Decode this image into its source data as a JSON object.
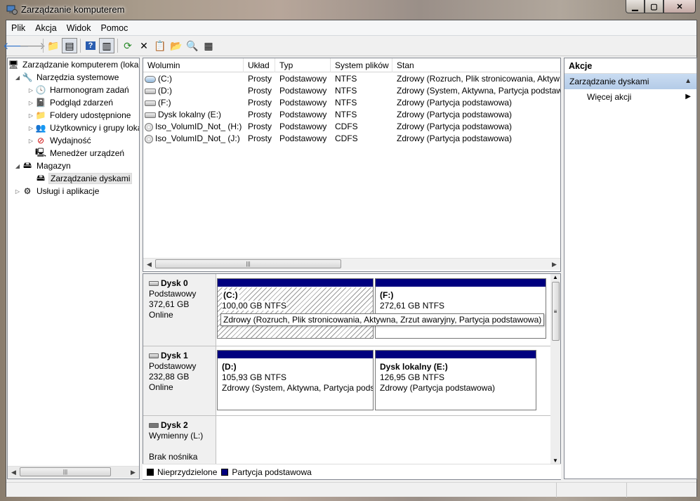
{
  "window": {
    "title": "Zarządzanie komputerem"
  },
  "menu": [
    "Plik",
    "Akcja",
    "Widok",
    "Pomoc"
  ],
  "toolbar_icons": [
    "back-icon",
    "forward-icon",
    "up-folder-icon",
    "show-tree-icon",
    "help-icon",
    "show-action-pane-icon",
    "refresh-icon",
    "delete-icon",
    "properties-icon",
    "open-icon",
    "find-icon",
    "settings-icon"
  ],
  "tree": {
    "root": "Zarządzanie komputerem (lokalne)",
    "system_tools": "Narzędzia systemowe",
    "task_scheduler": "Harmonogram zadań",
    "event_viewer": "Podgląd zdarzeń",
    "shared_folders": "Foldery udostępnione",
    "users_groups": "Użytkownicy i grupy lokalne",
    "performance": "Wydajność",
    "device_manager": "Menedżer urządzeń",
    "storage": "Magazyn",
    "disk_management": "Zarządzanie dyskami",
    "services_apps": "Usługi i aplikacje"
  },
  "volumes": {
    "columns": [
      "Wolumin",
      "Układ",
      "Typ",
      "System plików",
      "Stan"
    ],
    "rows": [
      {
        "name": "(C:)",
        "layout": "Prosty",
        "type": "Podstawowy",
        "fs": "NTFS",
        "status": "Zdrowy (Rozruch, Plik stronicowania, Aktywna, Zrzut awaryjny, Partycja podstawowa)",
        "icon": "volume-icon"
      },
      {
        "name": "(D:)",
        "layout": "Prosty",
        "type": "Podstawowy",
        "fs": "NTFS",
        "status": "Zdrowy (System, Aktywna, Partycja podstawowa)",
        "icon": "hdd-icon"
      },
      {
        "name": "(F:)",
        "layout": "Prosty",
        "type": "Podstawowy",
        "fs": "NTFS",
        "status": "Zdrowy (Partycja podstawowa)",
        "icon": "hdd-icon"
      },
      {
        "name": "Dysk lokalny (E:)",
        "layout": "Prosty",
        "type": "Podstawowy",
        "fs": "NTFS",
        "status": "Zdrowy (Partycja podstawowa)",
        "icon": "hdd-icon"
      },
      {
        "name": "Iso_VolumID_Not_ (H:)",
        "layout": "Prosty",
        "type": "Podstawowy",
        "fs": "CDFS",
        "status": "Zdrowy (Partycja podstawowa)",
        "icon": "cd-icon"
      },
      {
        "name": "Iso_VolumID_Not_ (J:)",
        "layout": "Prosty",
        "type": "Podstawowy",
        "fs": "CDFS",
        "status": "Zdrowy (Partycja podstawowa)",
        "icon": "cd-icon"
      }
    ]
  },
  "disks": [
    {
      "name": "Dysk 0",
      "kind": "Podstawowy",
      "size": "372,61 GB",
      "state": "Online",
      "partitions": [
        {
          "label": "(C:)",
          "size": "100,00 GB NTFS",
          "status": "Zdrowy (Rozruch, Plik stronicowania, Aktywna, Zrzut awaryjny, Partycja podstawowa)"
        },
        {
          "label": "(F:)",
          "size": "272,61 GB NTFS",
          "status": ""
        }
      ]
    },
    {
      "name": "Dysk 1",
      "kind": "Podstawowy",
      "size": "232,88 GB",
      "state": "Online",
      "partitions": [
        {
          "label": "(D:)",
          "size": "105,93 GB NTFS",
          "status": "Zdrowy (System, Aktywna, Partycja podstawowa)"
        },
        {
          "label": "Dysk lokalny  (E:)",
          "size": "126,95 GB NTFS",
          "status": "Zdrowy (Partycja podstawowa)"
        }
      ]
    },
    {
      "name": "Dysk 2",
      "kind": "Wymienny (L:)",
      "size": "",
      "state": "Brak nośnika",
      "partitions": []
    }
  ],
  "tooltip": "Zdrowy (Rozruch, Plik stronicowania, Aktywna, Zrzut awaryjny, Partycja podstawowa)",
  "legend": {
    "unallocated": "Nieprzydzielone",
    "primary": "Partycja podstawowa",
    "unallocated_color": "#000000",
    "primary_color": "#00007f"
  },
  "actions": {
    "header": "Akcje",
    "section": "Zarządzanie dyskami",
    "more": "Więcej akcji"
  },
  "colors": {
    "partition_bar": "#00007f",
    "action_section": "#c9dcf2"
  }
}
